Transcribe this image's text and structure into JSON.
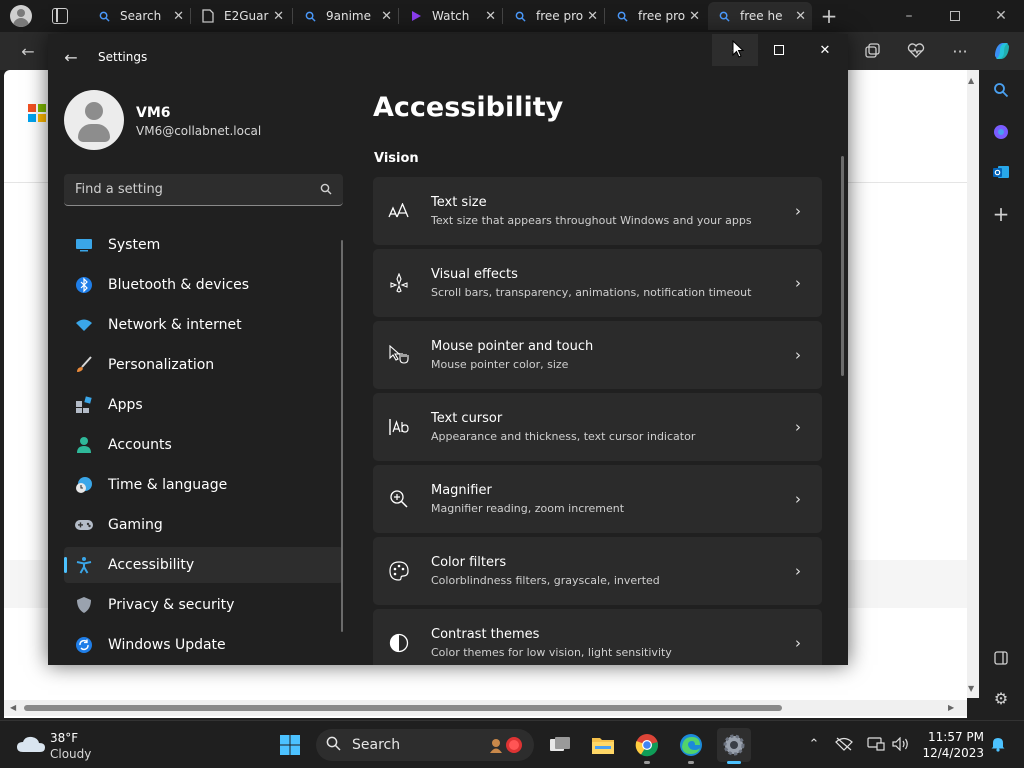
{
  "browser": {
    "tabs": [
      {
        "label": "Search",
        "icon": "search-tab-icon"
      },
      {
        "label": "E2Guar",
        "icon": "page-tab-icon"
      },
      {
        "label": "9anime",
        "icon": "search-tab-icon"
      },
      {
        "label": "Watch",
        "icon": "video-tab-icon"
      },
      {
        "label": "free pro",
        "icon": "search-tab-icon"
      },
      {
        "label": "free pro",
        "icon": "search-tab-icon"
      },
      {
        "label": "free he",
        "icon": "search-tab-icon"
      }
    ],
    "active_tab_index": 6
  },
  "settings": {
    "app_title": "Settings",
    "user": {
      "name": "VM6",
      "email": "VM6@collabnet.local"
    },
    "search_placeholder": "Find a setting",
    "nav": [
      {
        "label": "System",
        "icon": "system-icon"
      },
      {
        "label": "Bluetooth & devices",
        "icon": "bluetooth-icon"
      },
      {
        "label": "Network & internet",
        "icon": "network-icon"
      },
      {
        "label": "Personalization",
        "icon": "personalization-icon"
      },
      {
        "label": "Apps",
        "icon": "apps-icon"
      },
      {
        "label": "Accounts",
        "icon": "accounts-icon"
      },
      {
        "label": "Time & language",
        "icon": "time-language-icon"
      },
      {
        "label": "Gaming",
        "icon": "gaming-icon"
      },
      {
        "label": "Accessibility",
        "icon": "accessibility-icon",
        "selected": true
      },
      {
        "label": "Privacy & security",
        "icon": "privacy-icon"
      },
      {
        "label": "Windows Update",
        "icon": "windows-update-icon"
      }
    ],
    "page_title": "Accessibility",
    "section_title": "Vision",
    "cards": [
      {
        "title": "Text size",
        "subtitle": "Text size that appears throughout Windows and your apps",
        "icon": "text-size-icon"
      },
      {
        "title": "Visual effects",
        "subtitle": "Scroll bars, transparency, animations, notification timeout",
        "icon": "visual-effects-icon"
      },
      {
        "title": "Mouse pointer and touch",
        "subtitle": "Mouse pointer color, size",
        "icon": "mouse-pointer-icon"
      },
      {
        "title": "Text cursor",
        "subtitle": "Appearance and thickness, text cursor indicator",
        "icon": "text-cursor-icon"
      },
      {
        "title": "Magnifier",
        "subtitle": "Magnifier reading, zoom increment",
        "icon": "magnifier-icon"
      },
      {
        "title": "Color filters",
        "subtitle": "Colorblindness filters, grayscale, inverted",
        "icon": "color-filters-icon"
      },
      {
        "title": "Contrast themes",
        "subtitle": "Color themes for low vision, light sensitivity",
        "icon": "contrast-themes-icon"
      }
    ]
  },
  "taskbar": {
    "weather": {
      "temp": "38°F",
      "condition": "Cloudy"
    },
    "search_label": "Search",
    "clock": {
      "time": "11:57 PM",
      "date": "12/4/2023"
    }
  },
  "colors": {
    "accent": "#4cc2ff",
    "window_bg": "#202020",
    "card_bg": "#2b2b2b"
  }
}
